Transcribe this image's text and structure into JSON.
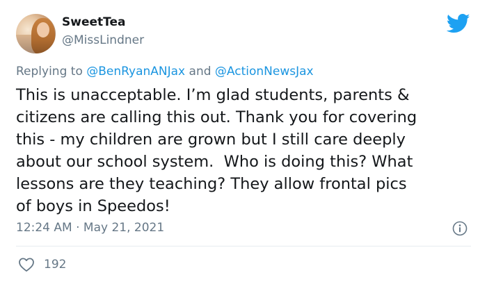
{
  "user": {
    "display_name": "SweetTea",
    "handle": "@MissLindner"
  },
  "reply": {
    "prefix": "Replying to ",
    "mention1": "@BenRyanANJax",
    "conjunction": " and ",
    "mention2": "@ActionNewsJax"
  },
  "tweet": {
    "text": "This is unacceptable. I’m glad students, parents &\ncitizens are calling this out. Thank you for covering\nthis - my children are grown but I still care deeply\nabout our school system.  Who is doing this? What\nlessons are they teaching? They allow frontal pics\nof boys in Speedos!",
    "time": "12:24 AM",
    "separator": " · ",
    "date": "May 21, 2021"
  },
  "engagement": {
    "likes": "192"
  },
  "icons": {
    "brand": "twitter-bird-icon",
    "info": "info-icon",
    "like": "heart-icon"
  },
  "colors": {
    "brand": "#1DA1F2",
    "mention": "#1B95E0",
    "secondary_text": "#657786",
    "divider": "#E6ECF0"
  }
}
